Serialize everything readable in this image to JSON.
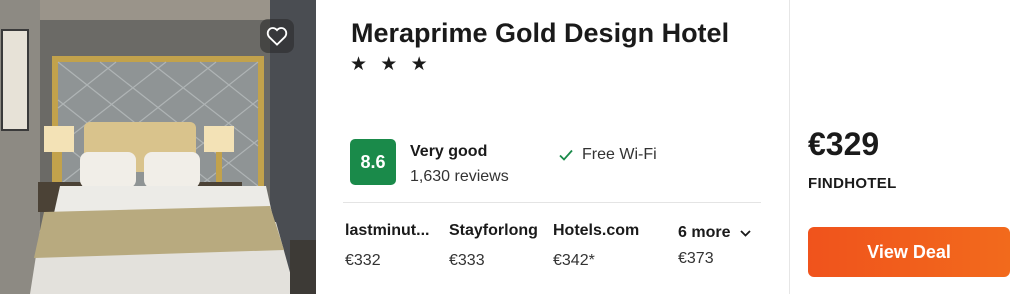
{
  "hotel": {
    "name": "Meraprime Gold Design Hotel",
    "stars_display": "★ ★ ★",
    "star_count": 3
  },
  "favorite": {
    "icon": "heart-icon"
  },
  "rating": {
    "score": "8.6",
    "label": "Very good",
    "reviews": "1,630 reviews",
    "color": "#1a8a4a"
  },
  "amenity": {
    "icon": "checkmark-icon",
    "label": "Free Wi-Fi",
    "icon_color": "#1a8a4a"
  },
  "providers": [
    {
      "name": "lastminut...",
      "price": "€332"
    },
    {
      "name": "Stayforlong",
      "price": "€333"
    },
    {
      "name": "Hotels.com",
      "price": "€342*"
    }
  ],
  "more": {
    "label": "6 more",
    "price": "€373",
    "icon": "chevron-down-icon"
  },
  "best": {
    "price": "€329",
    "site": "FINDHOTEL",
    "button_label": "View Deal",
    "button_color": "#f0531c"
  }
}
